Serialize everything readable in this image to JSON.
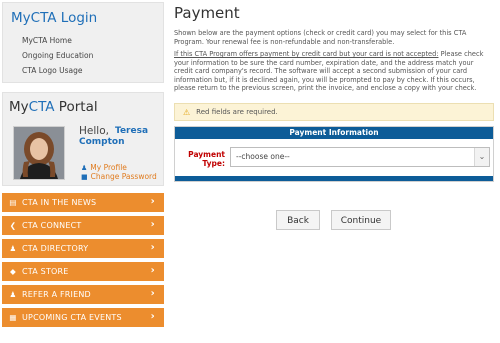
{
  "login": {
    "title": "MyCTA Login",
    "links": [
      "MyCTA Home",
      "Ongoing Education",
      "CTA Logo Usage"
    ]
  },
  "portal": {
    "title_prefix": "My",
    "title_accent": "CTA",
    "title_suffix": " Portal",
    "hello": "Hello,",
    "first_name": "Teresa",
    "last_name": "Compton",
    "profile_link": "My Profile",
    "password_link": "Change Password"
  },
  "nav": [
    {
      "label": "CTA IN THE NEWS",
      "icon": "newspaper-icon"
    },
    {
      "label": "CTA CONNECT",
      "icon": "share-icon"
    },
    {
      "label": "CTA DIRECTORY",
      "icon": "users-icon"
    },
    {
      "label": "CTA STORE",
      "icon": "tag-icon"
    },
    {
      "label": "REFER A FRIEND",
      "icon": "user-plus-icon"
    },
    {
      "label": "UPCOMING CTA EVENTS",
      "icon": "calendar-icon"
    }
  ],
  "payment": {
    "title": "Payment",
    "intro": "Shown below are the payment options (check or credit card) you may select for this CTA Program. Your renewal fee is non-refundable and non-transferable.",
    "notice_underlined": "If this CTA Program offers payment by credit card but your card is not accepted:",
    "notice_rest": " Please check your information to be sure the card number, expiration date, and the address match your credit card company's record. The software will accept a second submission of your card information but, if it is declined again, you will be prompted to pay by check. If this occurs, please return to the previous screen, print the invoice, and enclose a copy with your check.",
    "warning": "Red fields are required.",
    "panel_title": "Payment Information",
    "type_label_1": "Payment",
    "type_label_2": "Type:",
    "type_selected": "--choose one--",
    "back_label": "Back",
    "continue_label": "Continue"
  }
}
